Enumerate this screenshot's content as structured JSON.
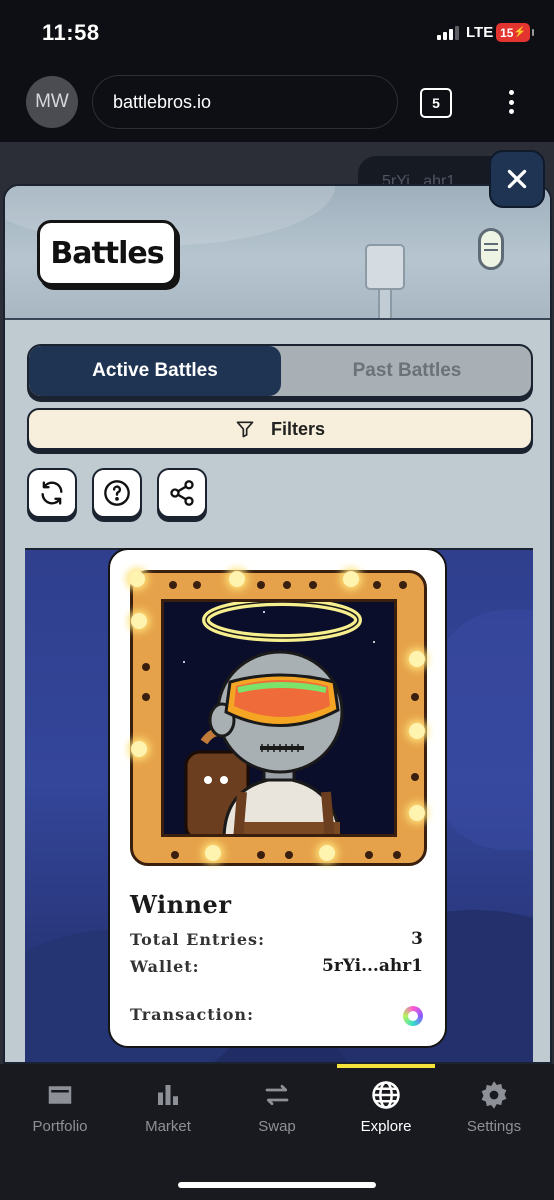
{
  "status_bar": {
    "time": "11:58",
    "network": "LTE",
    "battery": "15"
  },
  "browser": {
    "avatar_initials": "MW",
    "url": "battlebros.io",
    "tab_count": "5"
  },
  "background_pill": {
    "text": "5rYi...ahr1"
  },
  "modal": {
    "title": "Battles",
    "tabs": {
      "active": "Active Battles",
      "past": "Past Battles"
    },
    "filters_label": "Filters",
    "actions": [
      "refresh-icon",
      "help-icon",
      "share-icon"
    ]
  },
  "winner_card": {
    "heading": "Winner",
    "total_entries_label": "Total Entries:",
    "total_entries_value": "3",
    "wallet_label": "Wallet:",
    "wallet_value": "5rYi...ahr1",
    "transaction_label": "Transaction:"
  },
  "bottom_nav": {
    "items": [
      {
        "label": "Portfolio",
        "icon": "portfolio-icon"
      },
      {
        "label": "Market",
        "icon": "market-icon"
      },
      {
        "label": "Swap",
        "icon": "swap-icon"
      },
      {
        "label": "Explore",
        "icon": "explore-icon",
        "active": true
      },
      {
        "label": "Settings",
        "icon": "settings-icon"
      }
    ]
  },
  "colors": {
    "navy": "#1f3352",
    "cream": "#f7eedb",
    "accent_yellow": "#f5e23b",
    "battery_red": "#e3342f"
  }
}
